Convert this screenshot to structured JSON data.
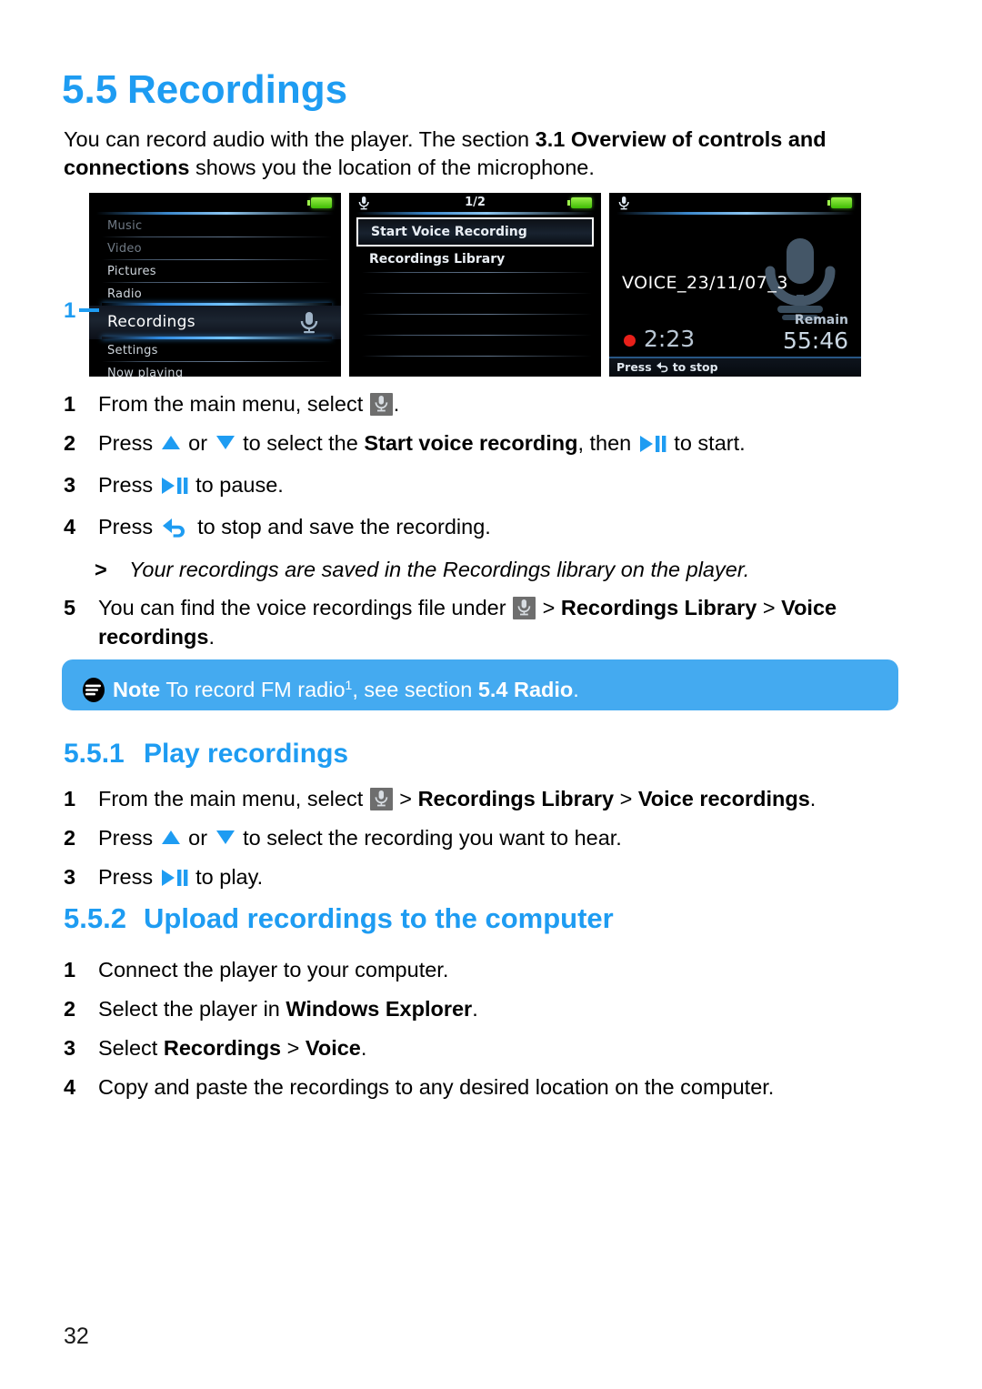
{
  "page": {
    "number": "32",
    "accent_blue": "#1e9cf2",
    "note_box_blue": "#44aaf0"
  },
  "heading": {
    "number": "5.5",
    "title": "Recordings"
  },
  "intro": {
    "part1": "You can record audio with the player. The section ",
    "bold1": "3.1 Overview of controls and connections",
    "part2": " shows you the location of the microphone."
  },
  "screens": {
    "callout_label": "1",
    "screen1": {
      "name": "main-menu-screen",
      "items": [
        "Music",
        "Video",
        "Pictures",
        "Radio",
        "Recordings",
        "Settings",
        "Now playing"
      ],
      "selected": "Recordings",
      "battery": "battery-icon"
    },
    "screen2": {
      "name": "recordings-menu-screen",
      "page_indicator": "1/2",
      "items": [
        "Start Voice Recording",
        "Recordings Library"
      ],
      "selected": "Start Voice Recording"
    },
    "screen3": {
      "name": "voice-recording-screen",
      "file_name": "VOICE_23/11/07_3",
      "remain_label": "Remain",
      "remain_time": "55:46",
      "elapsed_time": "2:23",
      "footer_prefix": "Press",
      "footer_suffix": "to stop"
    }
  },
  "steps_main": [
    {
      "index": "1",
      "segments": [
        {
          "type": "text",
          "value": "From the main menu, select "
        },
        {
          "type": "icon",
          "value": "mic-icon"
        },
        {
          "type": "text",
          "value": "."
        }
      ]
    },
    {
      "index": "2",
      "segments": [
        {
          "type": "text",
          "value": "Press "
        },
        {
          "type": "icon",
          "value": "triangle-up-icon"
        },
        {
          "type": "text",
          "value": " or "
        },
        {
          "type": "icon",
          "value": "triangle-down-icon"
        },
        {
          "type": "text",
          "value": " to select the "
        },
        {
          "type": "bold",
          "value": "Start voice recording"
        },
        {
          "type": "text",
          "value": ", then "
        },
        {
          "type": "icon",
          "value": "play-pause-icon"
        },
        {
          "type": "text",
          "value": " to start."
        }
      ]
    },
    {
      "index": "3",
      "segments": [
        {
          "type": "text",
          "value": "Press "
        },
        {
          "type": "icon",
          "value": "play-pause-icon"
        },
        {
          "type": "text",
          "value": " to pause."
        }
      ]
    },
    {
      "index": "4",
      "segments": [
        {
          "type": "text",
          "value": "Press "
        },
        {
          "type": "icon",
          "value": "back-arrow-icon"
        },
        {
          "type": "text",
          "value": " to stop and save the recording."
        }
      ]
    }
  ],
  "result_note": {
    "marker": ">",
    "text": "Your recordings are saved in the Recordings library on the player."
  },
  "step5": {
    "index": "5",
    "part1": "You can find the voice recordings file under ",
    "icon": "mic-icon",
    "part2": " > ",
    "bold1": "Recordings Library",
    "part3": " > ",
    "bold2": "Voice recordings",
    "part4": "."
  },
  "note_box": {
    "icon": "note-icon",
    "label": "Note",
    "text1": " To record FM radio",
    "superscript": "1",
    "text2": ", see section ",
    "bold": "5.4 Radio",
    "text3": "."
  },
  "section_551": {
    "number": "5.5.1",
    "title": "Play recordings",
    "steps": [
      {
        "index": "1",
        "part1": "From the main menu, select ",
        "icon": "mic-icon",
        "part2": " > ",
        "bold1": "Recordings Library",
        "part3": " > ",
        "bold2": "Voice recordings",
        "part4": "."
      },
      {
        "index": "2",
        "part1": "Press ",
        "part2": " or ",
        "part3": " to select the recording you want to hear."
      },
      {
        "index": "3",
        "part1": "Press ",
        "part2": " to play."
      }
    ]
  },
  "section_552": {
    "number": "5.5.2",
    "title": "Upload recordings to the computer",
    "steps": [
      {
        "index": "1",
        "text": "Connect the player to your computer."
      },
      {
        "index": "2",
        "part1": "Select the player in ",
        "bold1": "Windows Explorer",
        "part2": "."
      },
      {
        "index": "3",
        "part1": "Select ",
        "bold1": "Recordings",
        "part2": " > ",
        "bold2": "Voice",
        "part3": "."
      },
      {
        "index": "4",
        "text": "Copy and paste the recordings to any desired location on the computer."
      }
    ]
  }
}
